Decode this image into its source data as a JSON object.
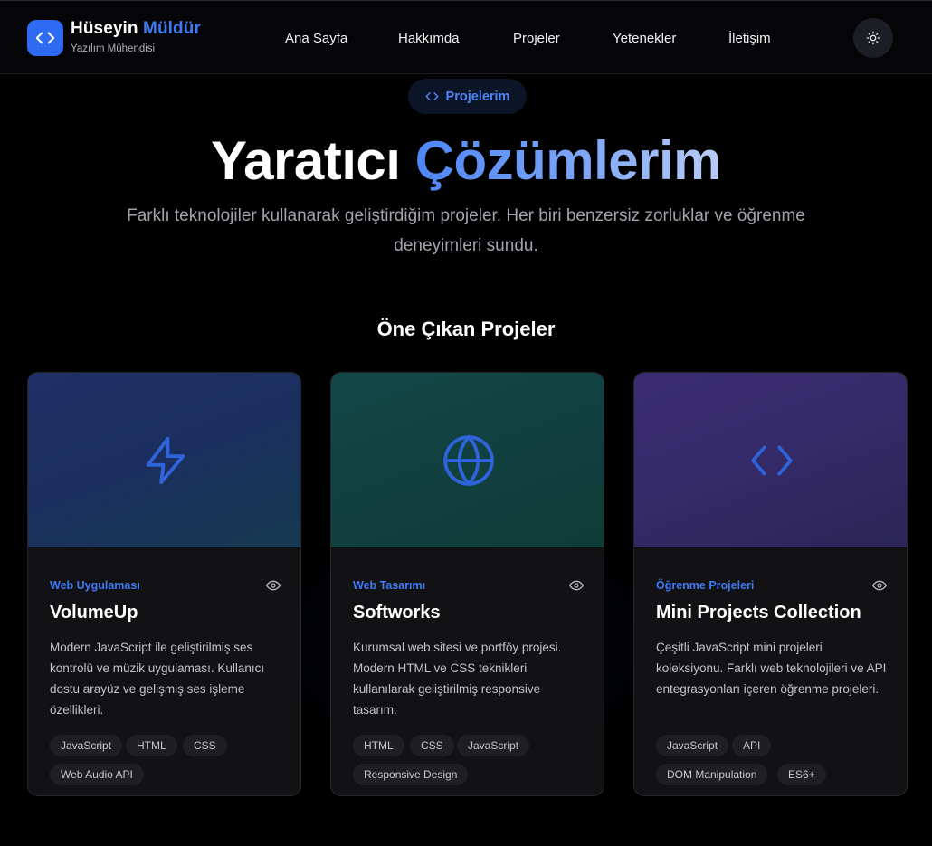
{
  "header": {
    "brand_first": "Hüseyin",
    "brand_last": "Müldür",
    "brand_subtitle": "Yazılım Mühendisi",
    "nav": [
      "Ana Sayfa",
      "Hakkımda",
      "Projeler",
      "Yetenekler",
      "İletişim"
    ],
    "theme_icon": "sun-icon"
  },
  "hero": {
    "pill_label": "Projelerim",
    "title_plain": "Yaratıcı",
    "title_accent": "Çözümlerim",
    "subtitle": "Farklı teknolojiler kullanarak geliştirdiğim projeler. Her biri benzersiz zorluklar ve öğrenme deneyimleri sundu."
  },
  "section": {
    "title": "Öne Çıkan Projeler"
  },
  "colors": {
    "accent": "#3b7bf5",
    "background": "#000000",
    "card": "#121214"
  },
  "projects": [
    {
      "category": "Web Uygulaması",
      "title": "VolumeUp",
      "description": "Modern JavaScript ile geliştirilmiş ses kontrolü ve müzik uygulaması. Kullanıcı dostu arayüz ve gelişmiş ses işleme özellikleri.",
      "tags": [
        "JavaScript",
        "HTML",
        "CSS",
        "Web Audio API"
      ],
      "icon": "lightning-icon"
    },
    {
      "category": "Web Tasarımı",
      "title": "Softworks",
      "description": "Kurumsal web sitesi ve portföy projesi. Modern HTML ve CSS teknikleri kullanılarak geliştirilmiş responsive tasarım.",
      "tags": [
        "HTML",
        "CSS",
        "JavaScript",
        "Responsive Design"
      ],
      "icon": "globe-icon"
    },
    {
      "category": "Öğrenme Projeleri",
      "title": "Mini Projects Collection",
      "description": "Çeşitli JavaScript mini projeleri koleksiyonu. Farklı web teknolojileri ve API entegrasyonları içeren öğrenme projeleri.",
      "tags": [
        "JavaScript",
        "API",
        "DOM Manipulation",
        "ES6+"
      ],
      "icon": "code-icon"
    }
  ]
}
